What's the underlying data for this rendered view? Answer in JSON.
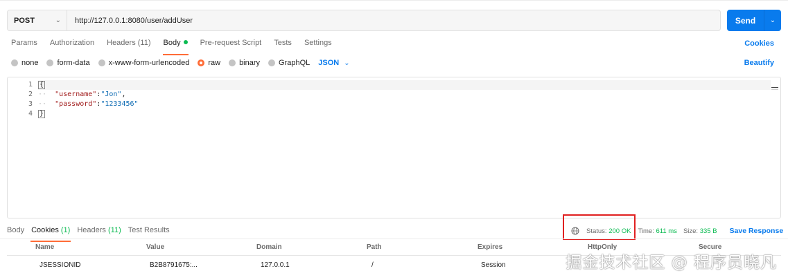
{
  "request": {
    "method": "POST",
    "url": "http://127.0.0.1:8080/user/addUser",
    "send_label": "Send"
  },
  "request_tabs": [
    {
      "label": "Params"
    },
    {
      "label": "Authorization"
    },
    {
      "label": "Headers (11)"
    },
    {
      "label": "Body",
      "active": true
    },
    {
      "label": "Pre-request Script"
    },
    {
      "label": "Tests"
    },
    {
      "label": "Settings"
    }
  ],
  "cookies_link": "Cookies",
  "beautify_link": "Beautify",
  "body_types": [
    {
      "label": "none"
    },
    {
      "label": "form-data"
    },
    {
      "label": "x-www-form-urlencoded"
    },
    {
      "label": "raw",
      "selected": true
    },
    {
      "label": "binary"
    },
    {
      "label": "GraphQL"
    }
  ],
  "body_format": "JSON",
  "editor": {
    "line_numbers": [
      "1",
      "2",
      "3",
      "4"
    ],
    "lines": {
      "l1": "{",
      "l2_key": "\"username\"",
      "l2_sep": ":",
      "l2_val": "\"Jon\"",
      "l2_end": ",",
      "l3_key": "\"password\"",
      "l3_sep": ":",
      "l3_val": "\"1233456\"",
      "l4": "}"
    }
  },
  "response_tabs": {
    "body": "Body",
    "cookies": "Cookies",
    "cookies_count": "(1)",
    "headers": "Headers",
    "headers_count": "(11)",
    "test_results": "Test Results"
  },
  "response_meta": {
    "status_label": "Status:",
    "status_value": "200 OK",
    "time_label": "Time:",
    "time_value": "611 ms",
    "size_label": "Size:",
    "size_value": "335 B",
    "save_response": "Save Response"
  },
  "cookie_table": {
    "headers": [
      "Name",
      "Value",
      "Domain",
      "Path",
      "Expires",
      "HttpOnly",
      "Secure"
    ],
    "rows": [
      [
        "JSESSIONID",
        "B2B8791675:...",
        "127.0.0.1",
        "/",
        "Session",
        "",
        ""
      ]
    ]
  },
  "watermark": "掘金技术社区 @ 程序员晓凡",
  "colors": {
    "accent_orange": "#ff6c37",
    "send_blue": "#097bed",
    "success_green": "#0cbb52",
    "highlight_red": "#e02020"
  }
}
